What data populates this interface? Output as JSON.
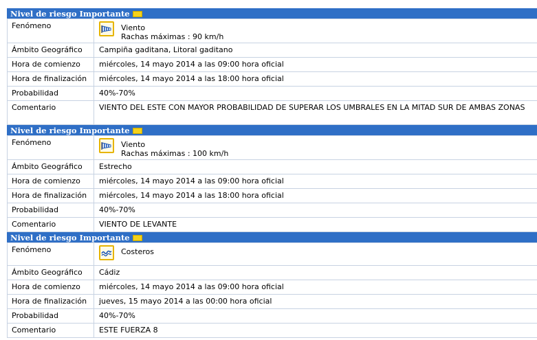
{
  "warnings": [
    {
      "header": "Nivel de riesgo Importante",
      "labels": {
        "fenomeno": "Fenómeno",
        "ambito": "Ámbito Geográfico",
        "inicio": "Hora de comienzo",
        "fin": "Hora de finalización",
        "prob": "Probabilidad",
        "comentario": "Comentario"
      },
      "phenomenon_icon": "wind-icon",
      "phenomenon": "Viento",
      "detail": "Rachas máximas : 90 km/h",
      "ambito": "Campiña gaditana, Litoral gaditano",
      "inicio": "miércoles, 14 mayo 2014 a las 09:00 hora oficial",
      "fin": "miércoles, 14 mayo 2014 a las 18:00 hora oficial",
      "probabilidad": "40%-70%",
      "comentario": "VIENTO DEL ESTE CON MAYOR PROBABILIDAD DE SUPERAR LOS UMBRALES EN LA MITAD SUR DE AMBAS ZONAS"
    },
    {
      "header": "Nivel de riesgo Importante",
      "labels": {
        "fenomeno": "Fenómeno",
        "ambito": "Ámbito Geográfico",
        "inicio": "Hora de comienzo",
        "fin": "Hora de finalización",
        "prob": "Probabilidad",
        "comentario": "Comentario"
      },
      "phenomenon_icon": "wind-icon",
      "phenomenon": "Viento",
      "detail": "Rachas máximas : 100 km/h",
      "ambito": "Estrecho",
      "inicio": "miércoles, 14 mayo 2014 a las 09:00 hora oficial",
      "fin": "miércoles, 14 mayo 2014 a las 18:00 hora oficial",
      "probabilidad": "40%-70%",
      "comentario": "VIENTO DE LEVANTE"
    },
    {
      "header": "Nivel de riesgo Importante",
      "labels": {
        "fenomeno": "Fenómeno",
        "ambito": "Ámbito Geográfico",
        "inicio": "Hora de comienzo",
        "fin": "Hora de finalización",
        "prob": "Probabilidad",
        "comentario": "Comentario"
      },
      "phenomenon_icon": "coastal-waves-icon",
      "phenomenon": "Costeros",
      "detail": "",
      "ambito": "Cádiz",
      "inicio": "miércoles, 14 mayo 2014 a las 09:00 hora oficial",
      "fin": "jueves, 15 mayo 2014 a las 00:00 hora oficial",
      "probabilidad": "40%-70%",
      "comentario": "ESTE FUERZA 8"
    }
  ],
  "colors": {
    "header_bg": "#2f6fc6",
    "badge": "#f5d21a",
    "icon_border": "#e6b400",
    "grid": "#c7d2e2"
  }
}
